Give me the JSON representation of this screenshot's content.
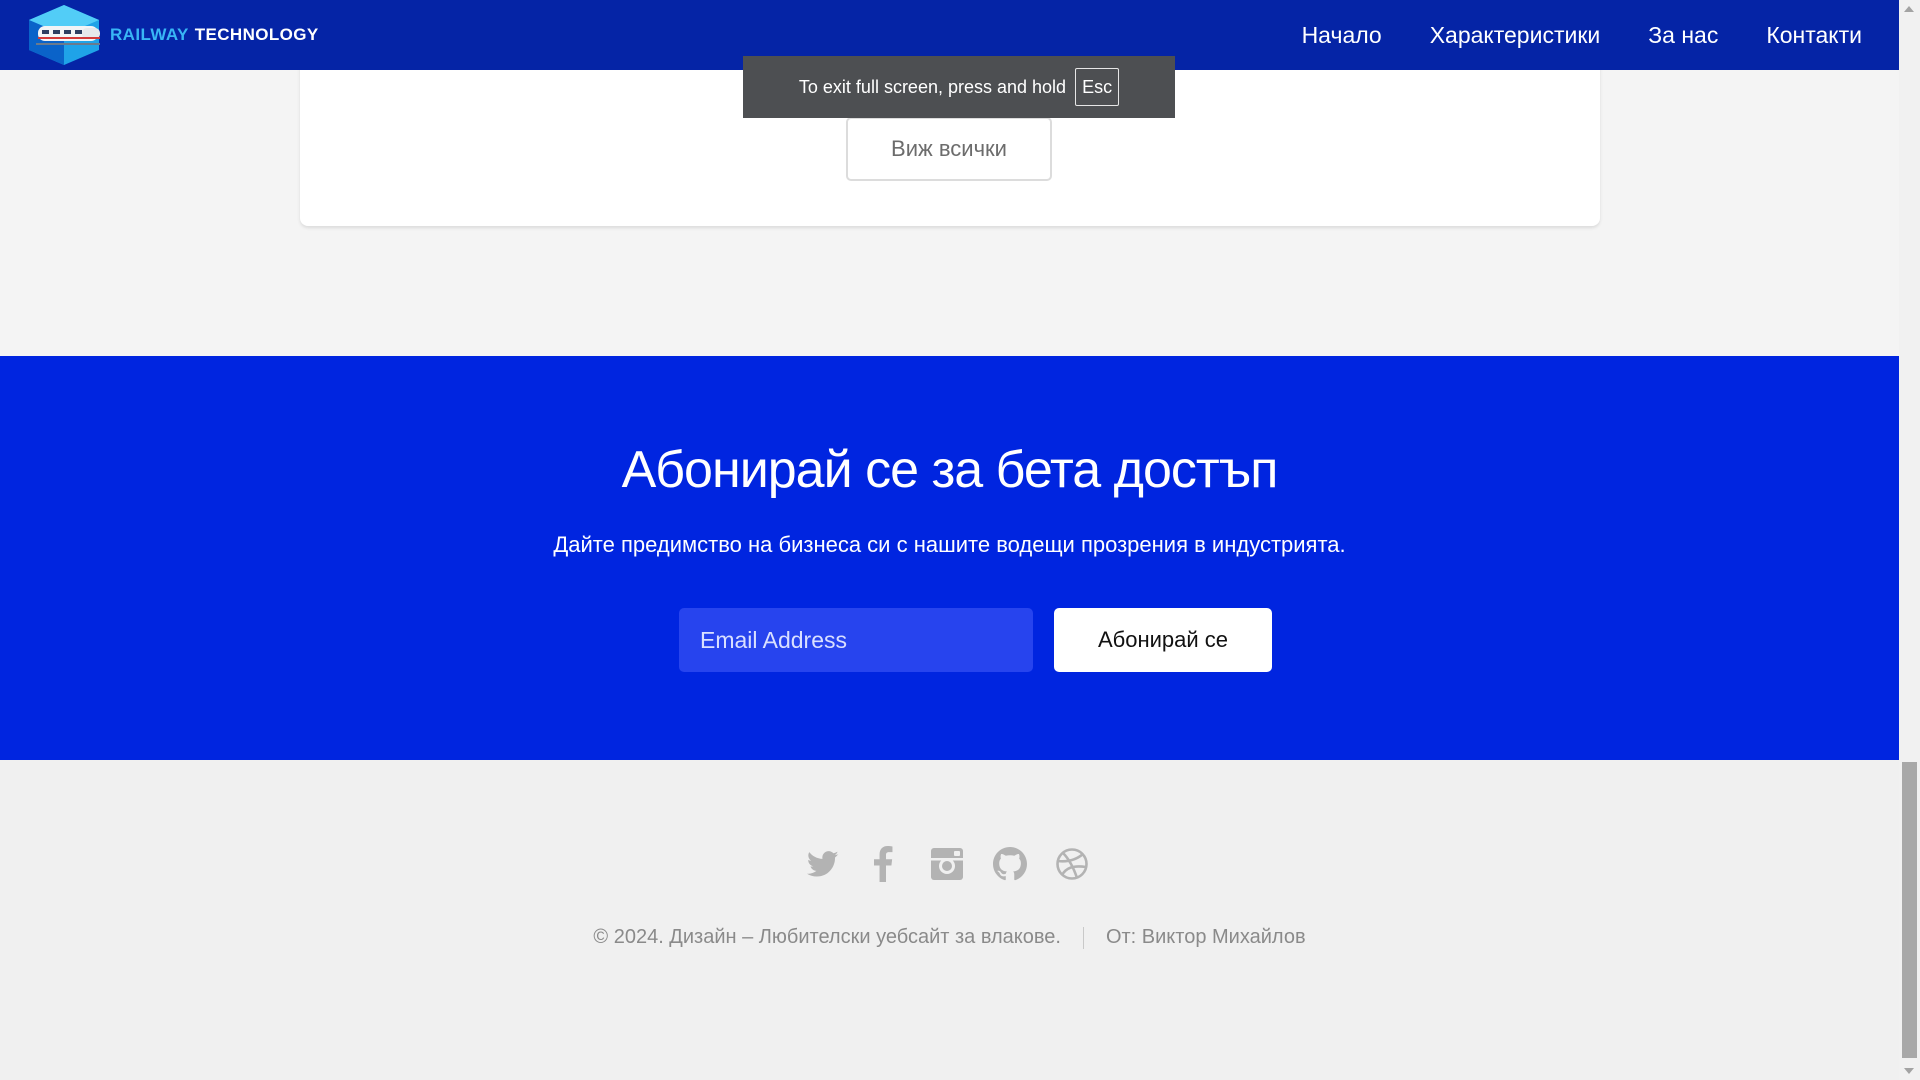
{
  "navbar": {
    "brand_first": "RAILWAY",
    "brand_second": "TECHNOLOGY",
    "links": [
      "Начало",
      "Характеристики",
      "За нас",
      "Контакти"
    ]
  },
  "fullscreen_notice": {
    "text": "To exit full screen, press and hold",
    "key": "Esc"
  },
  "card": {
    "view_all_label": "Виж всички"
  },
  "subscribe": {
    "title": "Абонирай се за бета достъп",
    "text": "Дайте предимство на бизнеса си с нашите водещи прозрения в индустрията.",
    "email_placeholder": "Email Address",
    "button_label": "Абонирай се"
  },
  "footer": {
    "social_icons": [
      "twitter-icon",
      "facebook-icon",
      "instagram-icon",
      "github-icon",
      "dribbble-icon"
    ],
    "copyright": "© 2024. Дизайн – Любителски уебсайт за влакове.",
    "author": "От: Виктор Михайлов"
  },
  "colors": {
    "navbar": "#0524a6",
    "brand_accent": "#38b6f5",
    "subscribe_bg": "#0025e0",
    "email_bg": "#2744ee",
    "footer_bg": "#f0f0f0",
    "footer_text": "#8a8a8a"
  }
}
